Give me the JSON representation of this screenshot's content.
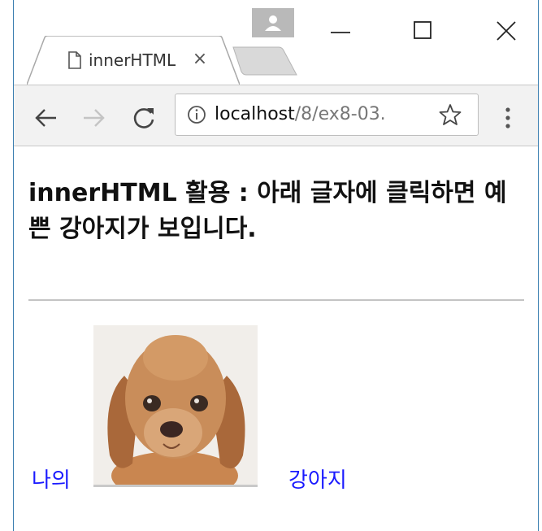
{
  "browser": {
    "tab": {
      "title": "innerHTML",
      "close_glyph": "×",
      "icon": "document-icon"
    },
    "window_controls": [
      "minimize-icon",
      "maximize-icon",
      "close-icon"
    ],
    "profile_icon": "person-icon",
    "toolbar": {
      "icons": [
        "back-arrow-icon",
        "forward-arrow-icon",
        "reload-icon",
        "info-icon",
        "star-icon",
        "kebab-menu-icon"
      ],
      "url_host": "localhost",
      "url_path": "/8/ex8-03."
    }
  },
  "page": {
    "heading": "innerHTML 활용 : 아래 글자에 클릭하면 예쁜 강아지가 보입니다.",
    "link_prefix": "나의",
    "link_suffix": "강아지",
    "image": "puppy-photo"
  },
  "colors": {
    "link": "#1a1aff",
    "window_border": "#3c7fb1",
    "toolbar_bg": "#f2f2f2"
  }
}
